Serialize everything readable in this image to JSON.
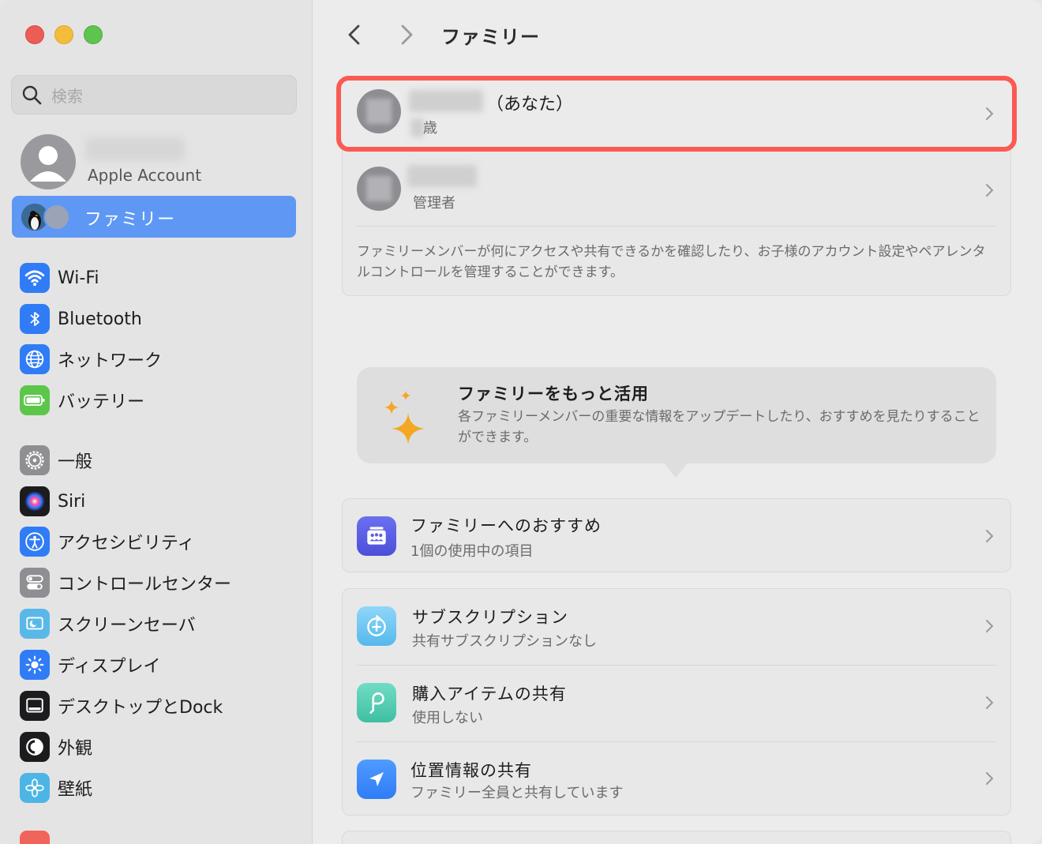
{
  "window": {
    "title": "ファミリー"
  },
  "sidebar": {
    "search_placeholder": "検索",
    "account": {
      "subtitle": "Apple Account"
    },
    "selected": {
      "label": "ファミリー"
    },
    "group1": [
      {
        "label": "Wi-Fi",
        "icon": "wifi-icon",
        "color": "#2f7cf6"
      },
      {
        "label": "Bluetooth",
        "icon": "bluetooth-icon",
        "color": "#2f7cf6"
      },
      {
        "label": "ネットワーク",
        "icon": "globe-icon",
        "color": "#2f7cf6"
      },
      {
        "label": "バッテリー",
        "icon": "battery-icon",
        "color": "#5cc64a"
      }
    ],
    "group2": [
      {
        "label": "一般",
        "icon": "gear-icon",
        "color": "#8e8e93"
      },
      {
        "label": "Siri",
        "icon": "siri-icon",
        "color": "#1c1c1e"
      },
      {
        "label": "アクセシビリティ",
        "icon": "accessibility-icon",
        "color": "#2f7cf6"
      },
      {
        "label": "コントロールセンター",
        "icon": "toggle-icon",
        "color": "#8e8e93"
      },
      {
        "label": "スクリーンセーバ",
        "icon": "screensaver-icon",
        "color": "#5ab8e8"
      },
      {
        "label": "ディスプレイ",
        "icon": "sun-icon",
        "color": "#2f7cf6"
      },
      {
        "label": "デスクトップとDock",
        "icon": "dock-icon",
        "color": "#1c1c1e"
      },
      {
        "label": "外観",
        "icon": "appearance-icon",
        "color": "#1c1c1e"
      },
      {
        "label": "壁紙",
        "icon": "flower-icon",
        "color": "#4db5e6"
      }
    ]
  },
  "main": {
    "title": "ファミリー",
    "members": [
      {
        "suffix": "（あなた）",
        "sub": "歳"
      },
      {
        "suffix": "",
        "sub": "管理者"
      }
    ],
    "members_desc": "ファミリーメンバーが何にアクセスや共有できるかを確認したり、お子様のアカウント設定やペアレンタルコントロールを管理することができます。",
    "promo": {
      "title": "ファミリーをもっと活用",
      "desc": "各ファミリーメンバーの重要な情報をアップデートしたり、おすすめを見たりすることができます。"
    },
    "recommend": {
      "title": "ファミリーへのおすすめ",
      "sub": "1個の使用中の項目"
    },
    "features": [
      {
        "title": "サブスクリプション",
        "sub": "共有サブスクリプションなし"
      },
      {
        "title": "購入アイテムの共有",
        "sub": "使用しない"
      },
      {
        "title": "位置情報の共有",
        "sub": "ファミリー全員と共有しています"
      }
    ]
  },
  "colors": {
    "accent": "#5e98f4",
    "highlight": "#fb5a52",
    "promo_star": "#f5a623"
  }
}
